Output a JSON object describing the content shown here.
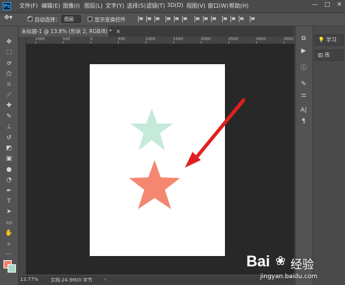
{
  "app": {
    "logo": "Ps"
  },
  "menu": [
    {
      "label": "文件(F)"
    },
    {
      "label": "编辑(E)"
    },
    {
      "label": "图像(I)"
    },
    {
      "label": "图层(L)"
    },
    {
      "label": "文字(Y)"
    },
    {
      "label": "选择(S)"
    },
    {
      "label": "滤镜(T)"
    },
    {
      "label": "3D(D)"
    },
    {
      "label": "视图(V)"
    },
    {
      "label": "窗口(W)"
    },
    {
      "label": "帮助(H)"
    }
  ],
  "window_controls": {
    "minimize": "—",
    "maximize": "□",
    "close": "✕"
  },
  "options": {
    "auto_select_label": "自动选择：",
    "auto_select_value": "图层",
    "show_transform_label": "显示变换控件"
  },
  "document": {
    "tab_title": "未标题-1 @ 13.8% (形状 2, RGB/8) *",
    "tab_close": "×"
  },
  "ruler": {
    "top_labels": [
      "1000",
      "500",
      "0",
      "500",
      "1000",
      "1500",
      "2000",
      "2500",
      "3000",
      "3500"
    ]
  },
  "tools": [
    {
      "icon": "move-icon",
      "glyph": "✥"
    },
    {
      "icon": "marquee-icon",
      "glyph": "⬚"
    },
    {
      "icon": "lasso-icon",
      "glyph": "ꝍ"
    },
    {
      "icon": "magic-wand-icon",
      "glyph": "⚝"
    },
    {
      "icon": "crop-icon",
      "glyph": "⌗"
    },
    {
      "icon": "eyedropper-icon",
      "glyph": "⟋"
    },
    {
      "icon": "healing-brush-icon",
      "glyph": "✚"
    },
    {
      "icon": "brush-icon",
      "glyph": "✎"
    },
    {
      "icon": "clone-stamp-icon",
      "glyph": "⊥"
    },
    {
      "icon": "history-brush-icon",
      "glyph": "↺"
    },
    {
      "icon": "eraser-icon",
      "glyph": "◩"
    },
    {
      "icon": "gradient-icon",
      "glyph": "▣"
    },
    {
      "icon": "blur-icon",
      "glyph": "●"
    },
    {
      "icon": "dodge-icon",
      "glyph": "◔"
    },
    {
      "icon": "pen-icon",
      "glyph": "✒"
    },
    {
      "icon": "type-icon",
      "glyph": "T"
    },
    {
      "icon": "path-select-icon",
      "glyph": "➤"
    },
    {
      "icon": "shape-icon",
      "glyph": "▭"
    },
    {
      "icon": "hand-icon",
      "glyph": "✋"
    },
    {
      "icon": "zoom-icon",
      "glyph": "⌕"
    },
    {
      "icon": "more-tools-icon",
      "glyph": "···"
    }
  ],
  "panel_strip": [
    {
      "icon": "history-panel-icon",
      "glyph": "⧉"
    },
    {
      "icon": "play-actions-icon",
      "glyph": "▶"
    },
    {
      "icon": "info-panel-icon",
      "glyph": "ⓘ"
    },
    {
      "icon": "brush-settings-icon",
      "glyph": "✎"
    },
    {
      "icon": "adjust-panel-icon",
      "glyph": "⚌"
    },
    {
      "icon": "character-panel-icon",
      "glyph": "A|"
    },
    {
      "icon": "paragraph-panel-icon",
      "glyph": "¶"
    }
  ],
  "side_panels": [
    {
      "icon": "lightbulb-icon",
      "label": "学习"
    },
    {
      "icon": "library-icon",
      "label": "库"
    }
  ],
  "status": {
    "zoom": "13.77%",
    "doc_info": "文档:24.9M/0 字节",
    "arrow": "›"
  },
  "shapes": {
    "star_top_color": "#c5ead9",
    "star_bottom_color": "#f4876f",
    "arrow_color": "#e02020"
  },
  "swatches": {
    "foreground": "#f0826e",
    "background": "#a8d8c8"
  },
  "watermark": {
    "brand": "Bai",
    "brand_suffix": "经验",
    "url": "jingyan.baidu.com"
  }
}
